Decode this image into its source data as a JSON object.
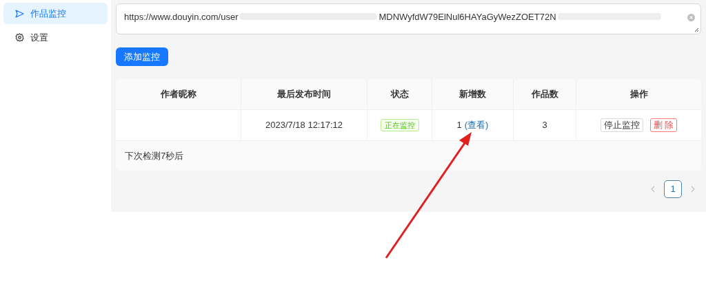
{
  "sidebar": {
    "items": [
      {
        "label": "作品监控",
        "kind": "send",
        "selected": true
      },
      {
        "label": "设置",
        "kind": "gear",
        "selected": false
      }
    ]
  },
  "url_field": {
    "value_start": "https://www.douyin.com/user",
    "value_end": "MDNWyfdW79ElNul6HAYaGyWezZOET72N"
  },
  "add_button": "添加监控",
  "table": {
    "columns": [
      "作者昵称",
      "最后发布时间",
      "状态",
      "新增数",
      "作品数",
      "操作"
    ],
    "rows": [
      {
        "last_post": "2023/7/18 12:17:12",
        "status": "正在监控",
        "new_count": "1",
        "view_link": "(查看)",
        "works": "3",
        "actions": [
          {
            "label": "停止监控",
            "kind": "default"
          },
          {
            "label": "删 除",
            "kind": "danger"
          }
        ]
      }
    ],
    "footer": "下次检测7秒后"
  },
  "pagination": {
    "pages": [
      {
        "label": "1",
        "selected": true
      }
    ]
  },
  "annotation": {
    "kind": "arrow"
  }
}
